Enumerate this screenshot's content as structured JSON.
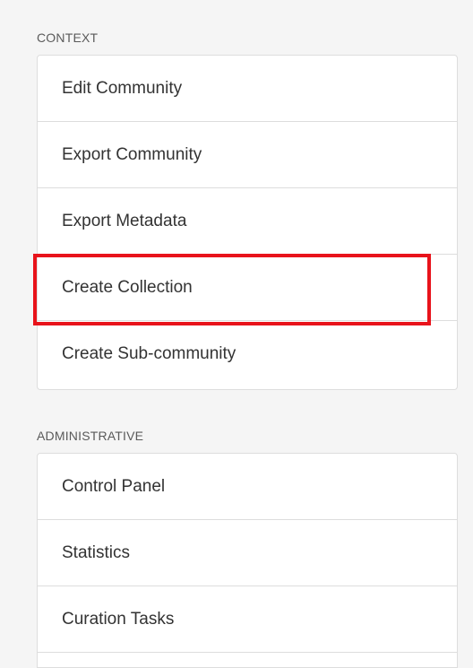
{
  "context": {
    "heading": "CONTEXT",
    "items": [
      {
        "label": "Edit Community"
      },
      {
        "label": "Export Community"
      },
      {
        "label": "Export Metadata"
      },
      {
        "label": "Create Collection"
      },
      {
        "label": "Create Sub-community"
      }
    ]
  },
  "administrative": {
    "heading": "ADMINISTRATIVE",
    "items": [
      {
        "label": "Control Panel"
      },
      {
        "label": "Statistics"
      },
      {
        "label": "Curation Tasks"
      }
    ]
  },
  "colors": {
    "highlight": "#e8131b"
  }
}
